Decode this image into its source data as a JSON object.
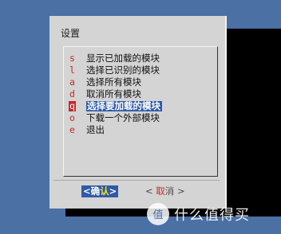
{
  "dialog": {
    "title": "设置"
  },
  "menu": {
    "items": [
      {
        "key": "s",
        "label": "显示已加载的模块",
        "selected": false
      },
      {
        "key": "l",
        "label": "选择已识别的模块",
        "selected": false
      },
      {
        "key": "a",
        "label": "选择所有模块",
        "selected": false
      },
      {
        "key": "d",
        "label": "取消所有模块",
        "selected": false
      },
      {
        "key": "q",
        "label": "选择要加载的模块",
        "selected": true
      },
      {
        "key": "o",
        "label": "下载一个外部模块",
        "selected": false
      },
      {
        "key": "e",
        "label": "退出",
        "selected": false
      }
    ]
  },
  "buttons": {
    "ok": {
      "open": "<",
      "label_main": "确",
      "label_hot": "认",
      "close": ">"
    },
    "cancel": {
      "open": "< ",
      "label_hot": "取",
      "label_main": "消",
      "close": " >"
    }
  },
  "watermark": {
    "text": "什么值得买",
    "logo_glyph": "值"
  },
  "colors": {
    "desktop": "#4b70a4",
    "dialog": "#d4d4d4",
    "highlight": "#2f5aa8",
    "hotkey": "#c62828"
  }
}
